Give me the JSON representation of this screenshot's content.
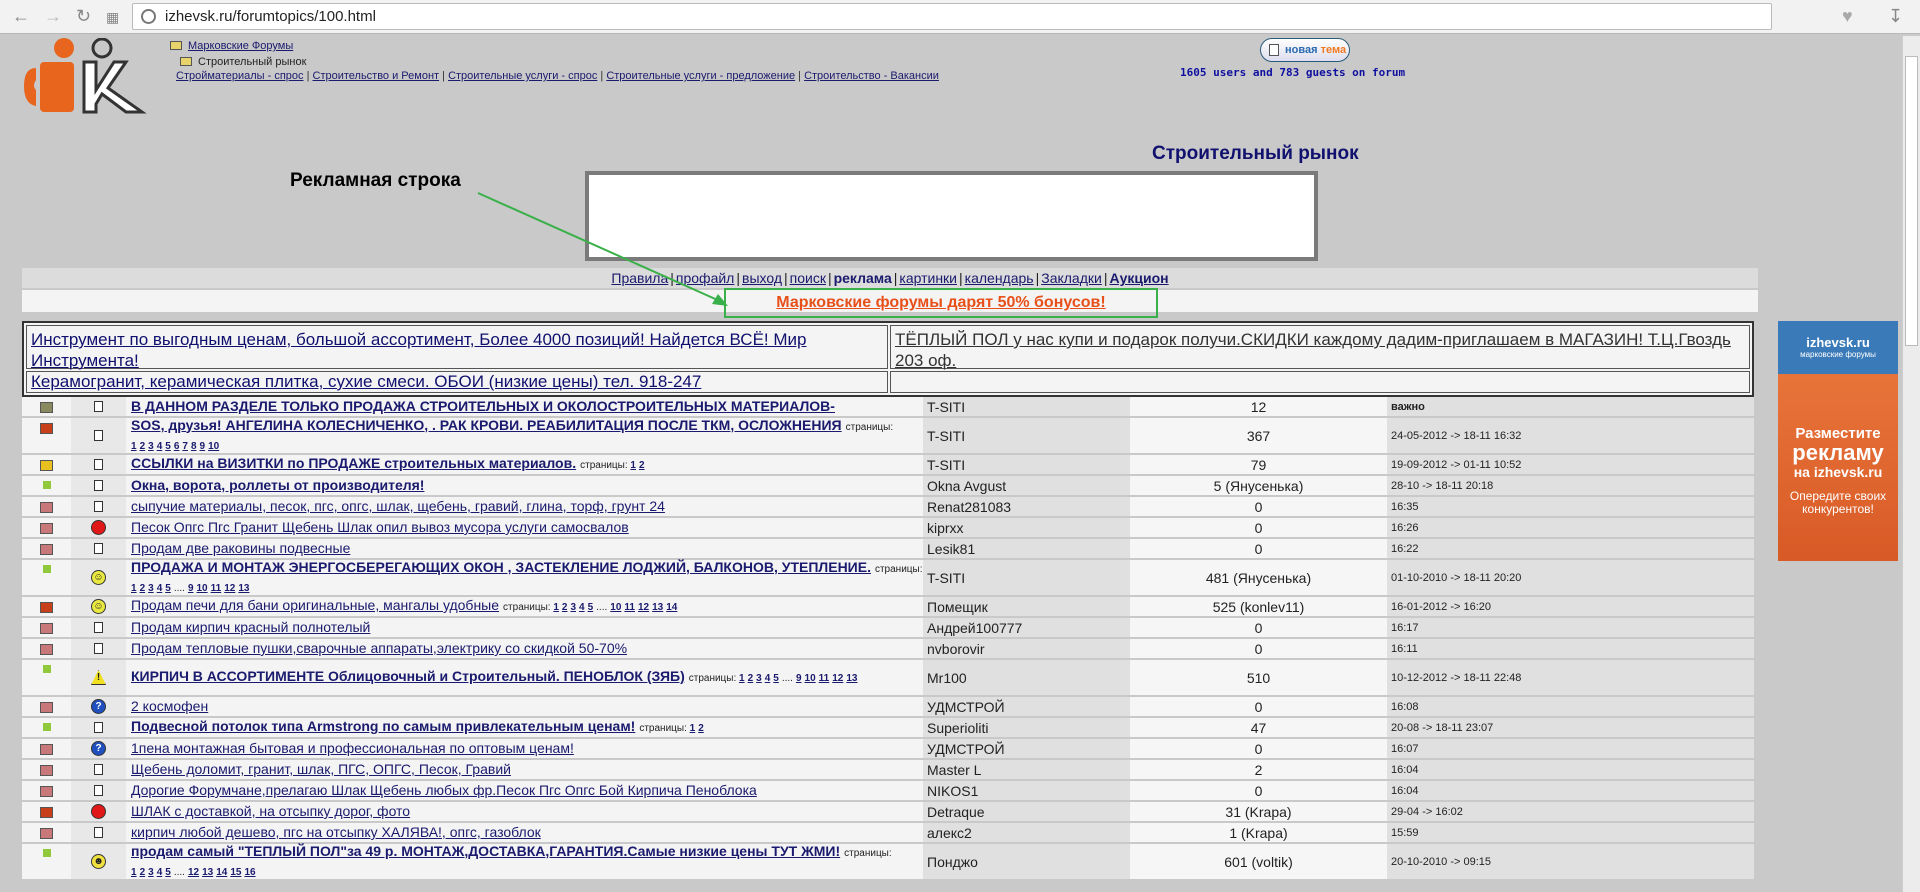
{
  "browser": {
    "url": "izhevsk.ru/forumtopics/100.html"
  },
  "breadcrumb": {
    "root": "Марковские Форумы",
    "current": "Строительный рынок"
  },
  "sublinks": [
    "Стройматериалы - спрос",
    "Строительство и Ремонт",
    "Строительные услуги - спрос",
    "Строительные услуги - предложение",
    "Строительство - Вакансии"
  ],
  "header": {
    "new_topic_a": "новая",
    "new_topic_b": "тема",
    "online": "1605 users and 783 guests on forum",
    "title": "Строительный рынок"
  },
  "annotation": {
    "label": "Рекламная строка",
    "color": "#3ab04a"
  },
  "nav": [
    "Правила",
    "профайл",
    "выход",
    "поиск",
    "реклама",
    "картинки",
    "календарь",
    "Закладки",
    "Аукцион"
  ],
  "promo": {
    "text": "Марковские форумы дарят 50% бонусов!",
    "color": "#e8501a"
  },
  "ads": {
    "a1": "Инструмент по выгодным ценам, большой ассортимент, Более 4000 позиций! Найдется ВСЁ! Мир Инструмента!",
    "a2": "ТЁПЛЫЙ ПОЛ у нас купи и подарок получи.СКИДКИ каждому дадим-приглашаем в МАГАЗИН! Т.Ц.Гвоздь 203 оф.",
    "a3": "Керамогранит, керамическая плитка, сухие смеси. ОБОИ (низкие цены) тел. 918-247"
  },
  "right_ad": {
    "brand": "izhevsk.ru",
    "sub": "марковские форумы",
    "l1": "Разместите",
    "l2": "рекламу",
    "l3": "на izhevsk.ru",
    "l4": "Опередите своих конкурентов!"
  },
  "pages_label": "страницы:",
  "topics": [
    {
      "icon": "lock",
      "mood": "doc",
      "title": "В ДАННОМ РАЗДЕЛЕ ТОЛЬКО ПРОДАЖА СТРОИТЕЛЬНЫХ И ОКОЛОСТРОИТЕЛЬНЫХ МАТЕРИАЛОВ-",
      "bold": true,
      "pages": [],
      "author": "T-SITI",
      "replies": "12",
      "last": "важно"
    },
    {
      "icon": "hot",
      "mood": "doc",
      "title": "SOS, друзья! АНГЕЛИНА КОЛЕСНИЧЕНКО, . РАК КРОВИ. РЕАБИЛИТАЦИЯ ПОСЛЕ ТКМ, ОСЛОЖНЕНИЯ",
      "bold": true,
      "pages": [
        "1",
        "2",
        "3",
        "4",
        "5",
        "6",
        "7",
        "8",
        "9",
        "10"
      ],
      "author": "T-SITI",
      "replies": "367",
      "last": "24-05-2012 -> 18-11 16:32",
      "tall": true
    },
    {
      "icon": "hot-yellow",
      "mood": "doc",
      "title": "ССЫЛКИ на ВИЗИТКИ по ПРОДАЖЕ строительных материалов.",
      "bold": true,
      "pages": [
        "1",
        "2"
      ],
      "author": "T-SITI",
      "replies": "79",
      "last": "19-09-2012 -> 01-11 10:52"
    },
    {
      "icon": "new",
      "mood": "doc",
      "title": "Окна, ворота, роллеты от производителя!",
      "bold": true,
      "pages": [],
      "author": "Okna Avgust",
      "replies": "5 (Янусенька)",
      "last": "28-10 -> 18-11 20:18"
    },
    {
      "icon": "folder",
      "mood": "doc",
      "title": "сыпучие материалы, песок, пгс, опгс, шлак, щебень, гравий, глина, торф, грунт 24",
      "bold": false,
      "pages": [],
      "author": "Renat281083",
      "replies": "0",
      "last": "16:35"
    },
    {
      "icon": "folder",
      "mood": "angry",
      "title": "Песок Опгс Пгс Гранит Щебень Шлак опил вывоз мусора услуги самосвалов",
      "bold": false,
      "pages": [],
      "author": "kiprxx",
      "replies": "0",
      "last": "16:26"
    },
    {
      "icon": "folder",
      "mood": "doc",
      "title": "Продам две раковины подвесные",
      "bold": false,
      "pages": [],
      "author": "Lesik81",
      "replies": "0",
      "last": "16:22"
    },
    {
      "icon": "new",
      "mood": "smile",
      "title": "ПРОДАЖА И МОНТАЖ ЭНЕРГОСБЕРЕГАЮЩИХ ОКОН , ЗАСТЕКЛЕНИЕ ЛОДЖИЙ, БАЛКОНОВ, УТЕПЛЕНИЕ.",
      "bold": true,
      "pages": [
        "1",
        "2",
        "3",
        "4",
        "5",
        "....",
        "9",
        "10",
        "11",
        "12",
        "13"
      ],
      "author": "T-SITI",
      "replies": "481 (Янусенька)",
      "last": "01-10-2010 -> 18-11 20:20",
      "tall": true
    },
    {
      "icon": "hot",
      "mood": "smile",
      "title": "Продам печи для бани оригинальные, мангалы удобные",
      "bold": false,
      "pages": [
        "1",
        "2",
        "3",
        "4",
        "5",
        "....",
        "10",
        "11",
        "12",
        "13",
        "14"
      ],
      "author": "Помещик",
      "replies": "525 (konlev11)",
      "last": "16-01-2012 -> 16:20"
    },
    {
      "icon": "folder",
      "mood": "doc",
      "title": "Продам кирпич красный полнотелый",
      "bold": false,
      "pages": [],
      "author": "Андрей100777",
      "replies": "0",
      "last": "16:17"
    },
    {
      "icon": "folder",
      "mood": "doc",
      "title": "Продам тепловые пушки,сварочные аппараты,электрику со скидкой 50-70%",
      "bold": false,
      "pages": [],
      "author": "nvborovir",
      "replies": "0",
      "last": "16:11"
    },
    {
      "icon": "new",
      "mood": "warning",
      "title": "КИРПИЧ В АССОРТИМЕНТЕ Облицовочный и Строительный. ПЕНОБЛОК (ЗЯБ)",
      "bold": true,
      "pages": [
        "1",
        "2",
        "3",
        "4",
        "5",
        "....",
        "9",
        "10",
        "11",
        "12",
        "13"
      ],
      "author": "Mr100",
      "replies": "510",
      "last": "10-12-2012 -> 18-11 22:48",
      "tall": true
    },
    {
      "icon": "folder",
      "mood": "question",
      "title": "2 космофен",
      "bold": false,
      "pages": [],
      "author": "УДМСТРОЙ",
      "replies": "0",
      "last": "16:08"
    },
    {
      "icon": "new",
      "mood": "doc",
      "title": "Подвесной потолок типа Armstrong по самым привлекательным ценам!",
      "bold": true,
      "pages": [
        "1",
        "2"
      ],
      "author": "Superioliti",
      "replies": "47",
      "last": "20-08 -> 18-11 23:07"
    },
    {
      "icon": "folder",
      "mood": "question",
      "title": "1пена монтажная бытовая и профессиональная по оптовым ценам!",
      "bold": false,
      "pages": [],
      "author": "УДМСТРОЙ",
      "replies": "0",
      "last": "16:07"
    },
    {
      "icon": "folder",
      "mood": "doc",
      "title": "Щебень доломит, гранит, шлак, ПГС, ОПГС, Песок, Гравий",
      "bold": false,
      "pages": [],
      "author": "Master L",
      "replies": "2",
      "last": "16:04"
    },
    {
      "icon": "folder",
      "mood": "doc",
      "title": "Дорогие Форумчане,прелагаю Шлак Щебень любых фр.Песок Пгс Опгс Бой Кирпича Пеноблока",
      "bold": false,
      "pages": [],
      "author": "NIKOS1",
      "replies": "0",
      "last": "16:04"
    },
    {
      "icon": "hot",
      "mood": "angry",
      "title": "ШЛАК с доставкой, на отсыпку дорог, фото",
      "bold": false,
      "pages": [],
      "author": "Detraque",
      "replies": "31 (Krapa)",
      "last": "29-04 -> 16:02"
    },
    {
      "icon": "folder",
      "mood": "doc",
      "title": "кирпич любой дешево, пгс на отсыпку ХАЛЯВА!, опгс, газоблок",
      "bold": false,
      "pages": [],
      "author": "алекс2",
      "replies": "1 (Krapa)",
      "last": "15:59"
    },
    {
      "icon": "new",
      "mood": "grin",
      "title": "продам самый \"ТЕПЛЫЙ ПОЛ\"за 49 р. МОНТАЖ,ДОСТАВКА,ГАРАНТИЯ.Самые низкие цены ТУТ ЖМИ!",
      "bold": true,
      "pages": [
        "1",
        "2",
        "3",
        "4",
        "5",
        "....",
        "12",
        "13",
        "14",
        "15",
        "16"
      ],
      "author": "Понджо",
      "replies": "601 (voltik)",
      "last": "20-10-2010 -> 09:15",
      "tall": true
    }
  ]
}
